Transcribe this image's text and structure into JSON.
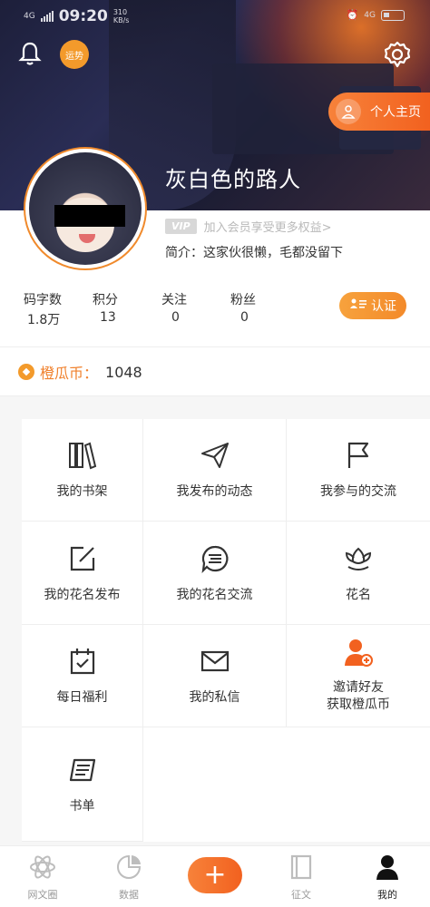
{
  "status_bar": {
    "network": "4G",
    "time": "09:20",
    "speed_value": "310",
    "speed_unit": "KB/s",
    "right_network": "4G"
  },
  "header": {
    "hot_badge": "运势",
    "homepage_button": "个人主页"
  },
  "profile": {
    "username": "灰白色的路人",
    "vip_tag": "VIP",
    "vip_text": "加入会员享受更多权益>",
    "bio": "简介：这家伙很懒，毛都没留下"
  },
  "stats": [
    {
      "label": "码字数",
      "value": "1.8万"
    },
    {
      "label": "积分",
      "value": "13"
    },
    {
      "label": "关注",
      "value": "0"
    },
    {
      "label": "粉丝",
      "value": "0"
    }
  ],
  "certify_button": "认证",
  "coins": {
    "label": "橙瓜币：",
    "value": "1048"
  },
  "menu": [
    {
      "label": "我的书架",
      "icon": "bookshelf-icon"
    },
    {
      "label": "我发布的动态",
      "icon": "paper-plane-icon"
    },
    {
      "label": "我参与的交流",
      "icon": "flag-icon"
    },
    {
      "label": "我的花名发布",
      "icon": "edit-square-icon"
    },
    {
      "label": "我的花名交流",
      "icon": "chat-bubble-icon"
    },
    {
      "label": "花名",
      "icon": "lotus-icon"
    },
    {
      "label": "每日福利",
      "icon": "calendar-check-icon"
    },
    {
      "label": "我的私信",
      "icon": "envelope-icon"
    },
    {
      "label": "邀请好友",
      "label2": "获取橙瓜币",
      "icon": "invite-user-icon"
    },
    {
      "label": "书单",
      "icon": "book-list-icon"
    }
  ],
  "tabs": [
    {
      "label": "网文圈",
      "icon": "atom-icon"
    },
    {
      "label": "数据",
      "icon": "pie-chart-icon"
    },
    {
      "label": "征文",
      "icon": "book-icon"
    },
    {
      "label": "我的",
      "icon": "user-icon"
    }
  ],
  "fab_label": "+",
  "colors": {
    "accent": "#f2611f",
    "coin": "#f0812d",
    "avatar_border": "#f08a2c"
  }
}
